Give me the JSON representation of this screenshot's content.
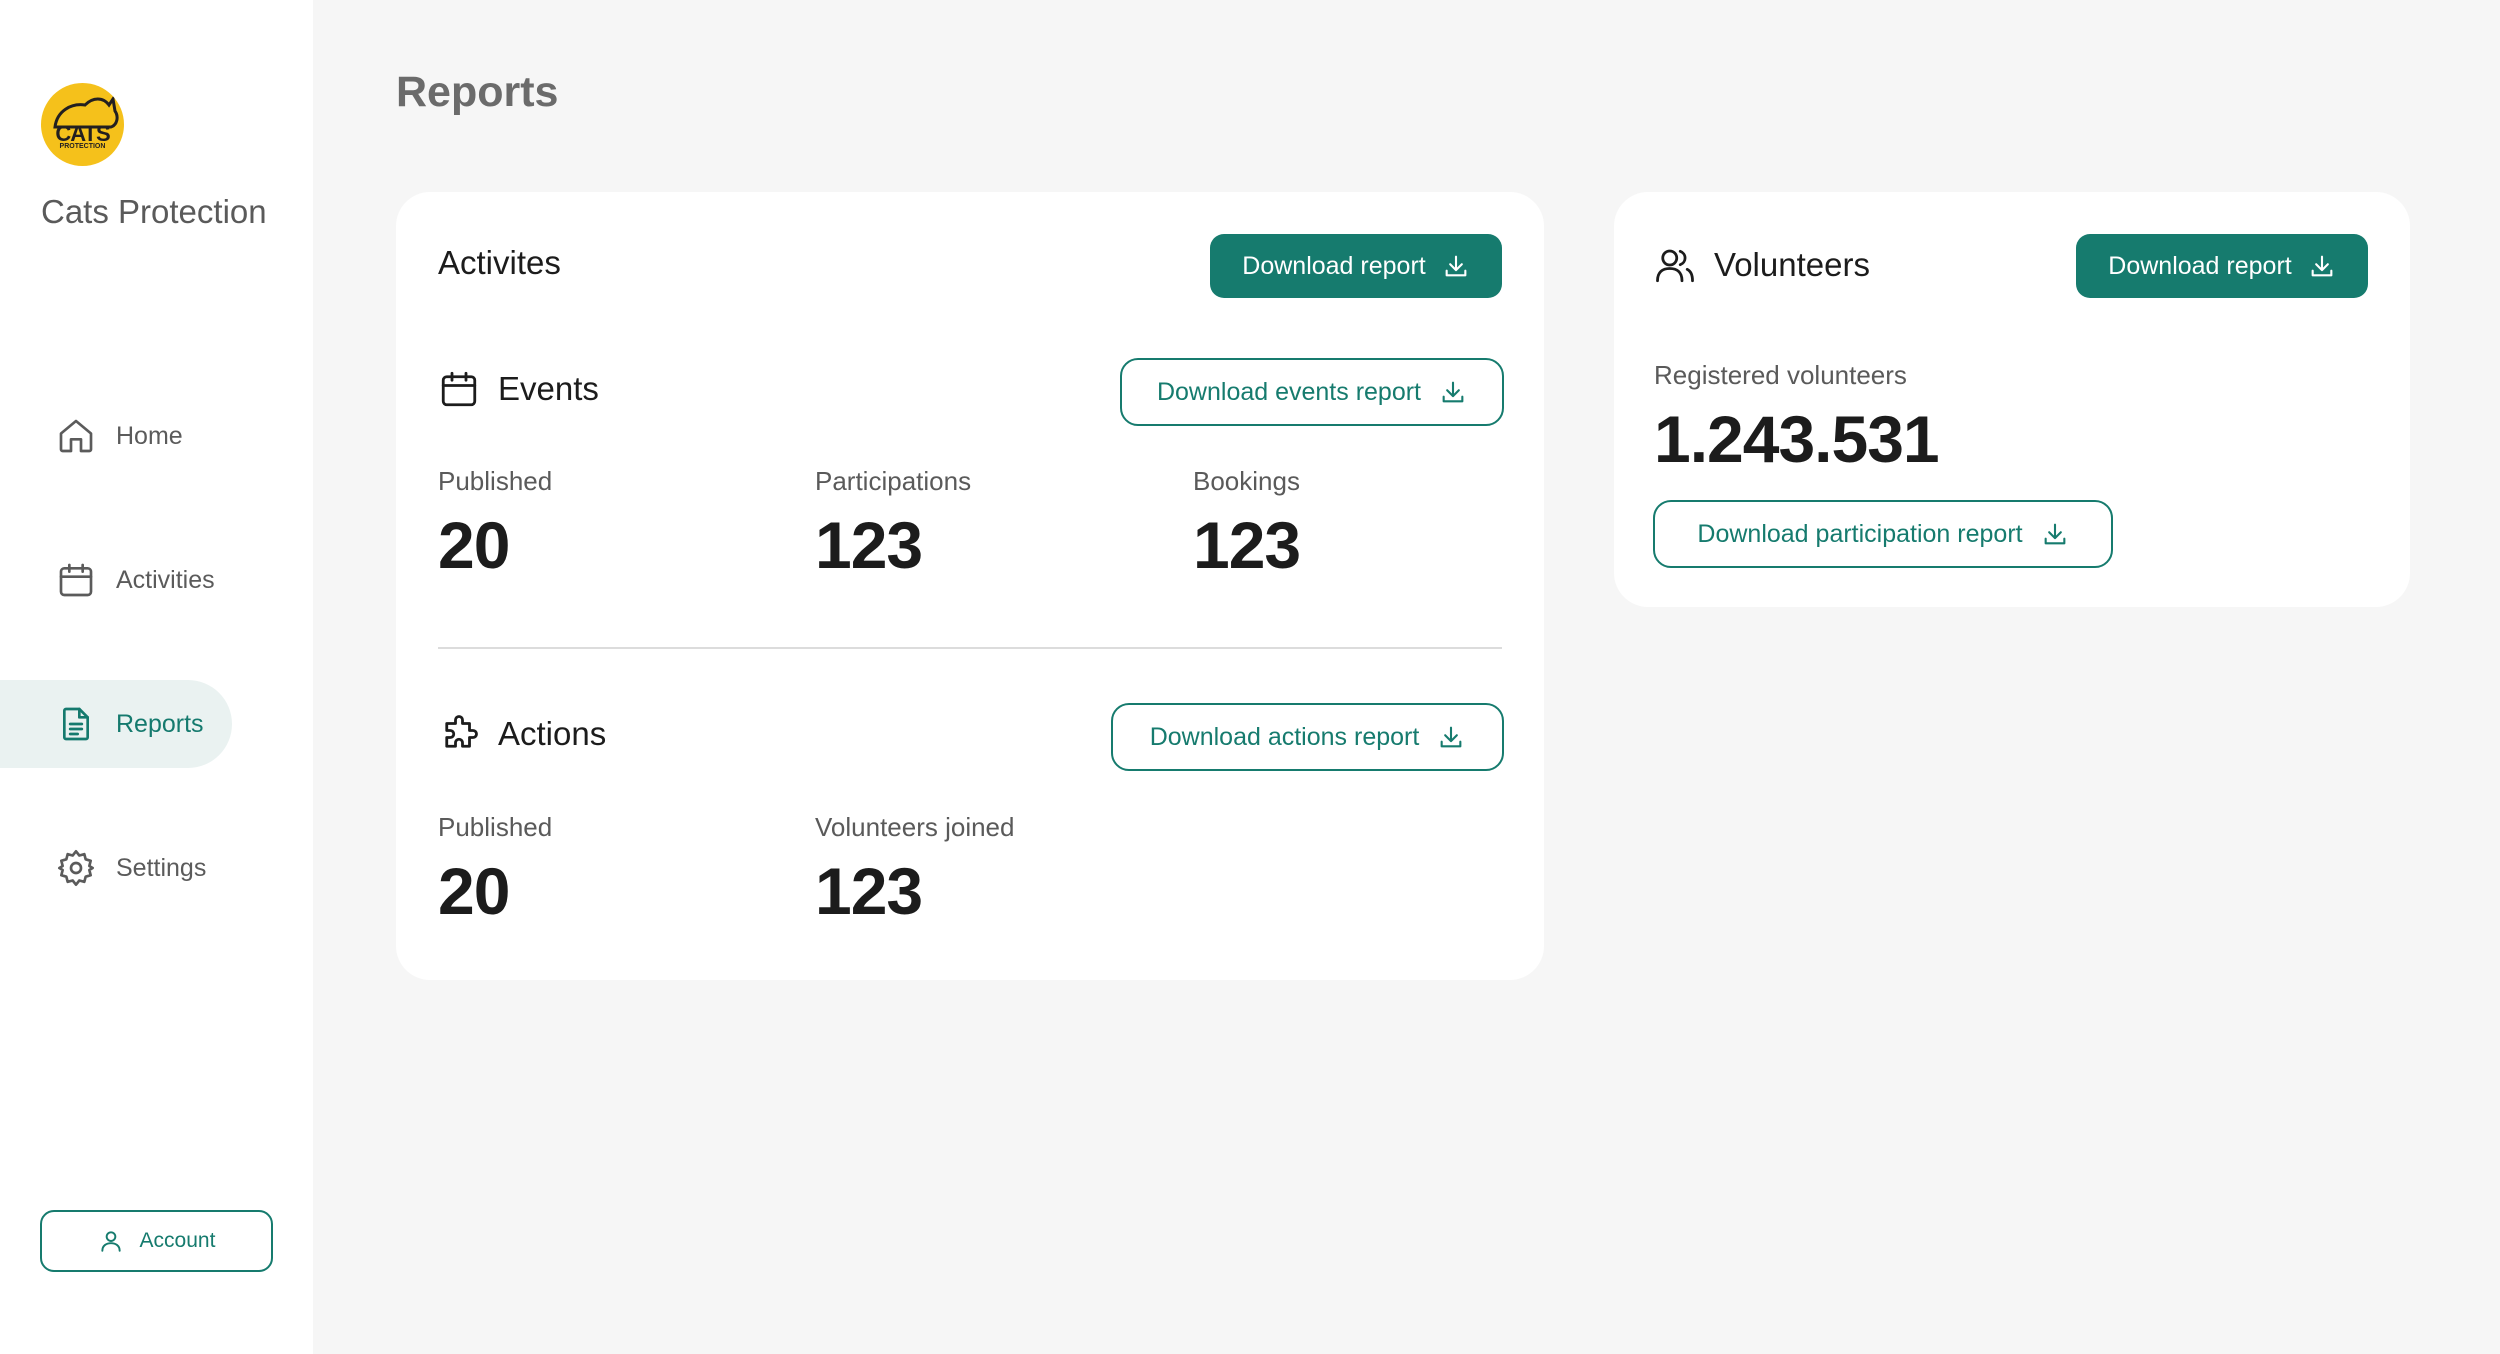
{
  "sidebar": {
    "logo_text": "CATS",
    "logo_sub": "PROTECTION",
    "brand": "Cats Protection",
    "items": [
      {
        "label": "Home",
        "icon": "home-icon"
      },
      {
        "label": "Activities",
        "icon": "calendar-icon"
      },
      {
        "label": "Reports",
        "icon": "document-icon",
        "active": true
      },
      {
        "label": "Settings",
        "icon": "gear-icon"
      }
    ],
    "account_label": "Account"
  },
  "page": {
    "title": "Reports"
  },
  "activities": {
    "title": "Activites",
    "download_label": "Download report",
    "events": {
      "title": "Events",
      "download_label": "Download events report",
      "stats": [
        {
          "label": "Published",
          "value": "20"
        },
        {
          "label": "Participations",
          "value": "123"
        },
        {
          "label": "Bookings",
          "value": "123"
        }
      ]
    },
    "actions": {
      "title": "Actions",
      "download_label": "Download actions report",
      "stats": [
        {
          "label": "Published",
          "value": "20"
        },
        {
          "label": "Volunteers joined",
          "value": "123"
        }
      ]
    }
  },
  "volunteers": {
    "title": "Volunteers",
    "download_label": "Download report",
    "registered_label": "Registered volunteers",
    "registered_value": "1.243.531",
    "participation_label": "Download participation report"
  },
  "colors": {
    "accent": "#167b6e",
    "active_bg": "#eaf2f1",
    "logo": "#f5c11b",
    "background": "#f6f6f6"
  }
}
